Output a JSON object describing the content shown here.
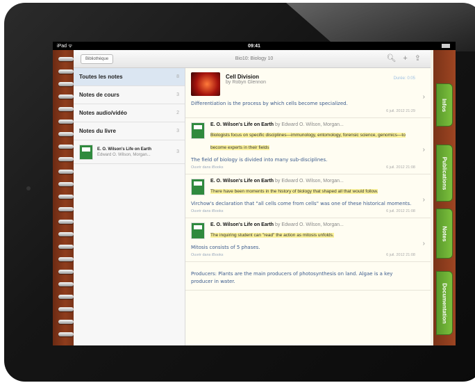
{
  "status_bar": {
    "carrier": "iPad ᯤ",
    "time": "09:41"
  },
  "toolbar": {
    "library_label": "Bibliothèque",
    "title": "Bio10: Biology 10",
    "icons": [
      "search-icon",
      "add-icon",
      "share-icon"
    ],
    "search_glyph": "🔍︎",
    "add_glyph": "+",
    "share_glyph": "⇪"
  },
  "sidebar": {
    "items": [
      {
        "label": "Toutes les notes",
        "count": "8"
      },
      {
        "label": "Notes de cours",
        "count": "3"
      },
      {
        "label": "Notes audio/vidéo",
        "count": "2"
      },
      {
        "label": "Notes du livre",
        "count": "3"
      }
    ],
    "book": {
      "title": "E. O. Wilson's Life on Earth",
      "author": "Edward O. Wilson, Morgan...",
      "count": "3"
    }
  },
  "notes": [
    {
      "title": "Cell Division",
      "byline": "by Robyn Glennon",
      "done": "Durée: 0:05",
      "text": "Differentiation is the process by which cells become specialized.",
      "date": "6 juil. 2012 21:29"
    },
    {
      "book_title": "E. O. Wilson's Life on Earth",
      "book_byline": "by Edward O. Wilson, Morgan...",
      "highlight": "Biologists focus on specific disciplines—immunology, entomology, forensic science, genomics—to become experts in their fields",
      "text": "The field of biology is divided into many sub-disciplines.",
      "link": "Ouvrir dans iBooks",
      "date": "6 juil. 2012 21:08"
    },
    {
      "book_title": "E. O. Wilson's Life on Earth",
      "book_byline": "by Edward O. Wilson, Morgan...",
      "highlight": "There have been moments in the history of biology that shaped all that would follow.",
      "text": "Virchow's declaration that \"all cells come from cells\" was one of these historical moments.",
      "link": "Ouvrir dans iBooks",
      "date": "6 juil. 2012 21:08"
    },
    {
      "book_title": "E. O. Wilson's Life on Earth",
      "book_byline": "by Edward O. Wilson, Morgan...",
      "highlight": "The inquiring student can \"read\" the action as mitosis unfolds.",
      "text": "Mitosis consists of 5 phases.",
      "link": "Ouvrir dans iBooks",
      "date": "6 juil. 2012 21:08"
    },
    {
      "text": "Producers: Plants are the main producers of photosynthesis on land. Algae is a key producer in water."
    }
  ],
  "tabs": [
    "Infos",
    "Publications",
    "Notes",
    "Documentation"
  ],
  "chevron": "›"
}
